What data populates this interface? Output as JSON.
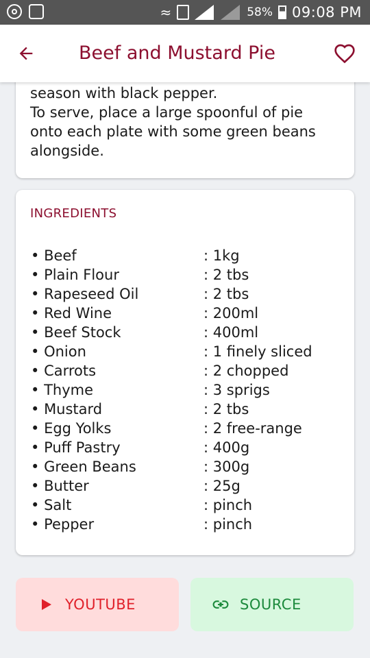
{
  "status_bar": {
    "battery": "58%",
    "time": "09:08 PM"
  },
  "app_bar": {
    "title": "Beef and Mustard Pie"
  },
  "method": {
    "lines": [
      "season with black pepper.",
      "To serve, place a large spoonful of pie onto each plate with some green beans alongside."
    ]
  },
  "ingredients": {
    "heading": "INGREDIENTS",
    "items": [
      {
        "name": "Beef",
        "qty": ": 1kg"
      },
      {
        "name": "Plain Flour",
        "qty": ": 2 tbs"
      },
      {
        "name": "Rapeseed Oil",
        "qty": ": 2 tbs"
      },
      {
        "name": "Red Wine",
        "qty": ": 200ml"
      },
      {
        "name": "Beef Stock",
        "qty": ": 400ml"
      },
      {
        "name": "Onion",
        "qty": ": 1 finely sliced"
      },
      {
        "name": "Carrots",
        "qty": ": 2 chopped"
      },
      {
        "name": "Thyme",
        "qty": ": 3 sprigs"
      },
      {
        "name": "Mustard",
        "qty": ": 2 tbs"
      },
      {
        "name": "Egg Yolks",
        "qty": ": 2 free-range"
      },
      {
        "name": "Puff Pastry",
        "qty": ": 400g"
      },
      {
        "name": "Green Beans",
        "qty": ": 300g"
      },
      {
        "name": "Butter",
        "qty": ": 25g"
      },
      {
        "name": "Salt",
        "qty": ": pinch"
      },
      {
        "name": "Pepper",
        "qty": ": pinch"
      }
    ]
  },
  "buttons": {
    "youtube": {
      "label": "YOUTUBE",
      "icon": "play-icon",
      "color": "#e0202a"
    },
    "source": {
      "label": "SOURCE",
      "icon": "link-icon",
      "color": "#1c8a3c"
    }
  },
  "colors": {
    "accent": "#8c0f2f",
    "background": "#eef0f3"
  }
}
